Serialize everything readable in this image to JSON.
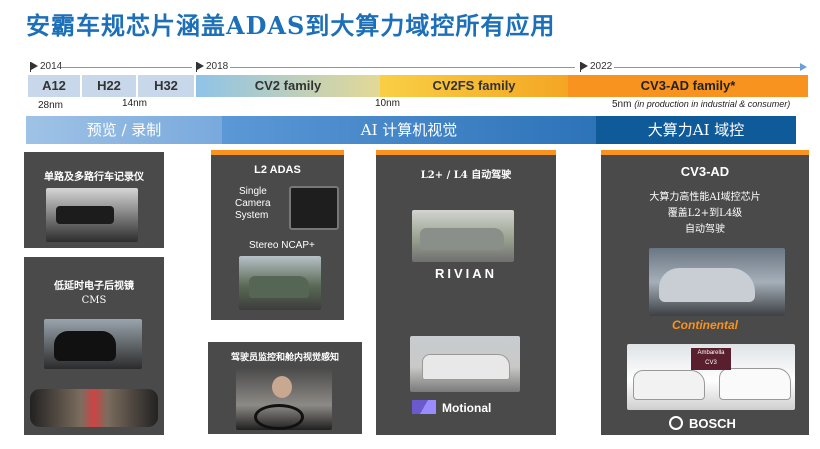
{
  "title": "安霸车规芯片涵盖ADAS到大算力域控所有应用",
  "timeline": {
    "years": [
      "2014",
      "2018",
      "2022"
    ],
    "chips_2014": [
      {
        "label": "A12",
        "color": "#c9d7ea"
      },
      {
        "label": "H22",
        "color": "#c9d7ea"
      },
      {
        "label": "H32",
        "color": "#c9d7ea"
      }
    ],
    "families": [
      "CV2 family",
      "CV2FS family",
      "CV3-AD family*"
    ],
    "process": {
      "nm28": "28nm",
      "nm14": "14nm",
      "nm10": "10nm",
      "nm5": "5nm",
      "nm5_note": "(in production in industrial & consumer)"
    }
  },
  "bands": {
    "left": "预览 / 录制",
    "mid": "AI 计算机视觉",
    "right": "大算力AI 域控"
  },
  "panels": {
    "p1": {
      "title": "单路及多路行车记录仪"
    },
    "p2": {
      "title1": "低延时电子后视镜",
      "title2": "CMS"
    },
    "p3": {
      "title": "L2 ADAS",
      "single": "Single",
      "camera": "Camera",
      "system": "System",
      "ncap": "Stereo NCAP+"
    },
    "p4": {
      "title": "驾驶员监控和舱内视觉感知"
    },
    "p5": {
      "title": "L2+ / L4 自动驾驶",
      "rivian": "RIVIAN",
      "motional": "Motional"
    },
    "p6": {
      "title": "CV3-AD",
      "l1": "大算力高性能AI域控芯片",
      "l2": "覆盖L2+到L4级",
      "l3": "自动驾驶",
      "continental": "Continental",
      "ambarella_label1": "Ambarella",
      "ambarella_label2": "CV3",
      "bosch": "BOSCH"
    }
  },
  "colors": {
    "accent_blue": "#1d6fb8",
    "orange": "#f7931e",
    "panel_gray": "#4a4a4a"
  }
}
